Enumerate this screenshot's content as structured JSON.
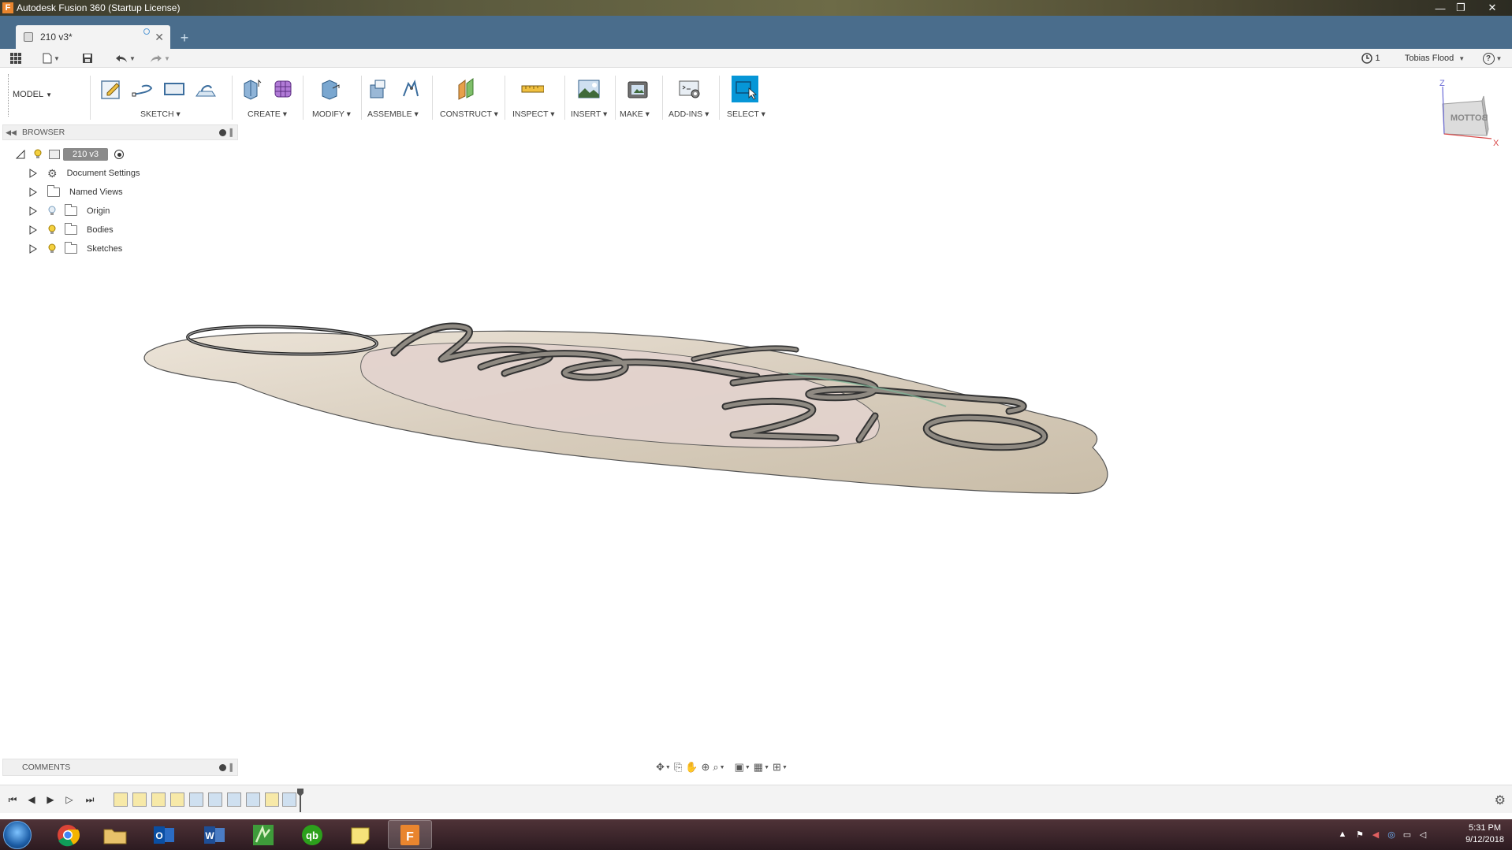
{
  "window": {
    "title": "Autodesk Fusion 360 (Startup License)",
    "minimize": "—",
    "restore": "❐",
    "close": "✕"
  },
  "tabs": {
    "active_label": "210 v3*",
    "new_tab": "+"
  },
  "quick_access": {
    "job_count": "1",
    "user_name": "Tobias Flood",
    "help": "?"
  },
  "toolbar": {
    "workspace": "MODEL",
    "groups": {
      "sketch": "SKETCH",
      "create": "CREATE",
      "modify": "MODIFY",
      "assemble": "ASSEMBLE",
      "construct": "CONSTRUCT",
      "inspect": "INSPECT",
      "insert": "INSERT",
      "make": "MAKE",
      "addins": "ADD-INS",
      "select": "SELECT"
    },
    "accent_color": "#0696d7"
  },
  "browser": {
    "title": "BROWSER",
    "root": "210 v3",
    "items": [
      {
        "label": "Document Settings",
        "icon": "gear-icon"
      },
      {
        "label": "Named Views",
        "icon": "folder-icon"
      },
      {
        "label": "Origin",
        "icon": "folder-icon",
        "visibility": "bulb-off"
      },
      {
        "label": "Bodies",
        "icon": "folder-icon",
        "visibility": "bulb-on"
      },
      {
        "label": "Sketches",
        "icon": "folder-icon",
        "visibility": "bulb-on"
      }
    ]
  },
  "comments": {
    "title": "COMMENTS"
  },
  "viewcube": {
    "face_label": "BOTTOM",
    "axis_z": "Z",
    "axis_x": "X"
  },
  "taskbar": {
    "apps": [
      "chrome-icon",
      "explorer-icon",
      "outlook-icon",
      "word-icon",
      "sketchbook-icon",
      "quickbooks-icon",
      "notes-icon",
      "fusion360-icon"
    ],
    "active_app": "fusion360-icon",
    "time": "5:31 PM",
    "date": "9/12/2018"
  }
}
